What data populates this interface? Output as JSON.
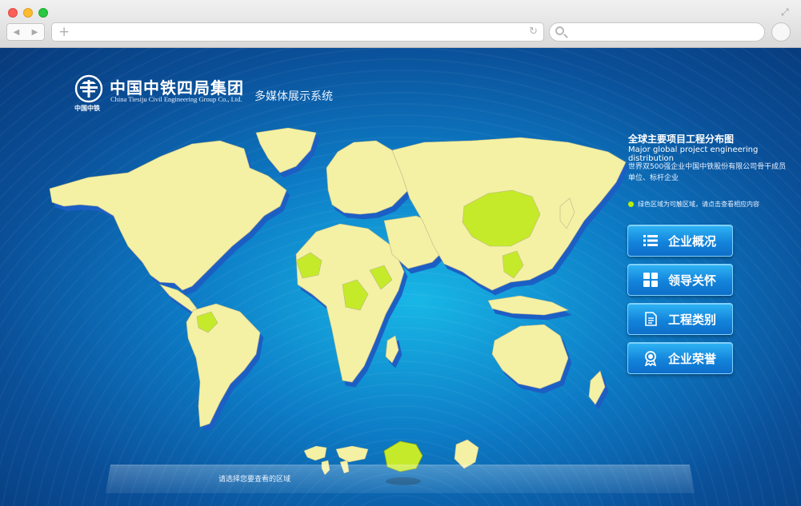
{
  "browser": {
    "nav_back": "◀",
    "nav_forward": "▶",
    "url_plus": "+",
    "reload": "↻"
  },
  "brand": {
    "title": "中国中铁四局集团",
    "english": "China Tiesiju Civil Engineering Group Co., Ltd.",
    "logo_caption": "中国中铁",
    "subtitle": "多媒体展示系统"
  },
  "info": {
    "title": "全球主要项目工程分布图",
    "title_en": "Major global project engineering distribution",
    "desc_line1": "世界双500强企业中国中铁股份有限公司骨干成员",
    "desc_line2": "单位、标杆企业",
    "hint": "绿色区域为可触区域，请点击查看相应内容"
  },
  "menu": {
    "items": [
      {
        "label": "企业概况",
        "icon": "list-icon"
      },
      {
        "label": "领导关怀",
        "icon": "grid-icon"
      },
      {
        "label": "工程类别",
        "icon": "document-icon"
      },
      {
        "label": "企业荣誉",
        "icon": "award-icon"
      }
    ]
  },
  "region_selector": {
    "label": "请选择您要查看的区域"
  },
  "colors": {
    "land": "#f4f1a4",
    "active": "#b8e600",
    "shadow": "#1756b8",
    "ocean": "#0d7cc6"
  }
}
